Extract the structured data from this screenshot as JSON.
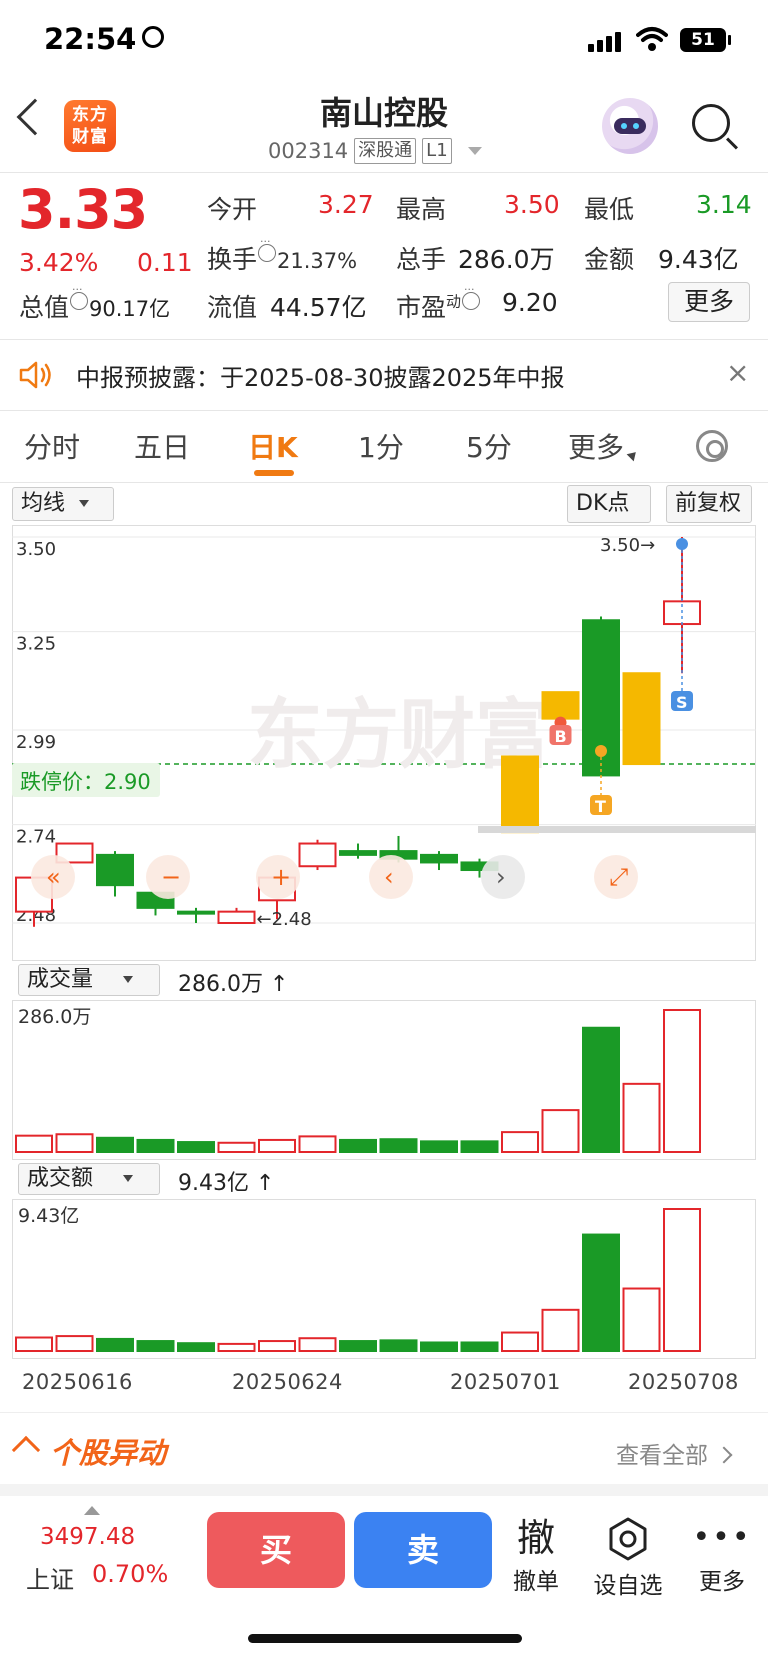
{
  "status_bar": {
    "time": "22:54",
    "battery": "51"
  },
  "header": {
    "logo_line1": "东方",
    "logo_line2": "财富",
    "stock_name": "南山控股",
    "stock_code": "002314",
    "connect_tag": "深股通",
    "level_tag": "L1"
  },
  "quote": {
    "price": "3.33",
    "change_pct": "3.42%",
    "change_amt": "0.11",
    "total_value_label": "总值",
    "total_value": "90.17亿",
    "rows": [
      [
        {
          "label": "今开",
          "value": "3.27",
          "color": "red"
        },
        {
          "label": "最高",
          "value": "3.50",
          "color": "red"
        },
        {
          "label": "最低",
          "value": "3.14",
          "color": "green"
        }
      ],
      [
        {
          "label": "换手",
          "value": "21.37%",
          "color": "dark"
        },
        {
          "label": "总手",
          "value": "286.0万",
          "color": "dark"
        },
        {
          "label": "金额",
          "value": "9.43亿",
          "color": "dark"
        }
      ],
      [
        {
          "label": "流值",
          "value": "44.57亿",
          "color": "dark"
        },
        {
          "label": "市盈",
          "value": "9.20",
          "color": "dark",
          "sup": "动"
        }
      ]
    ],
    "more_button": "更多"
  },
  "notice": {
    "text": "中报预披露：于2025-08-30披露2025年中报",
    "close": "×"
  },
  "tabs": [
    "分时",
    "五日",
    "日K",
    "1分",
    "5分",
    "更多"
  ],
  "active_tab": "日K",
  "colors": {
    "up": "#e3262b",
    "down": "#1a9a26",
    "accent": "#f07a12",
    "signal": "#f5b800",
    "limit_line": "#1a9a26"
  },
  "kline": {
    "indicator_selector": "均线",
    "dk_button": "DK点",
    "adjust_button": "前复权",
    "price_ticks": [
      "3.50",
      "3.25",
      "2.99",
      "2.74",
      "2.48"
    ],
    "limit_down_label": "跌停价：2.90",
    "max_marker": "3.50",
    "min_marker": "2.48",
    "signals": {
      "buy": "B",
      "sell": "S",
      "t": "T"
    }
  },
  "volume_panel": {
    "selector": "成交量",
    "value": "286.0万",
    "axis_max": "286.0万"
  },
  "amount_panel": {
    "selector": "成交额",
    "value": "9.43亿",
    "axis_max": "9.43亿"
  },
  "dates": [
    "20250616",
    "20250624",
    "20250701",
    "20250708"
  ],
  "chart_data": {
    "type": "candlestick",
    "ylim": [
      2.48,
      3.5
    ],
    "candles": [
      {
        "o": 2.51,
        "c": 2.6,
        "h": 2.6,
        "l": 2.47,
        "dir": "up"
      },
      {
        "o": 2.64,
        "c": 2.69,
        "h": 2.69,
        "l": 2.64,
        "dir": "up"
      },
      {
        "o": 2.66,
        "c": 2.58,
        "h": 2.67,
        "l": 2.55,
        "dir": "down"
      },
      {
        "o": 2.56,
        "c": 2.52,
        "h": 2.56,
        "l": 2.5,
        "dir": "down"
      },
      {
        "o": 2.51,
        "c": 2.51,
        "h": 2.52,
        "l": 2.48,
        "dir": "down"
      },
      {
        "o": 2.48,
        "c": 2.51,
        "h": 2.52,
        "l": 2.48,
        "dir": "up"
      },
      {
        "o": 2.54,
        "c": 2.6,
        "h": 2.6,
        "l": 2.49,
        "dir": "up"
      },
      {
        "o": 2.63,
        "c": 2.69,
        "h": 2.7,
        "l": 2.62,
        "dir": "up"
      },
      {
        "o": 2.67,
        "c": 2.66,
        "h": 2.69,
        "l": 2.65,
        "dir": "down"
      },
      {
        "o": 2.67,
        "c": 2.65,
        "h": 2.71,
        "l": 2.64,
        "dir": "down"
      },
      {
        "o": 2.66,
        "c": 2.64,
        "h": 2.67,
        "l": 2.62,
        "dir": "down"
      },
      {
        "o": 2.64,
        "c": 2.62,
        "h": 2.65,
        "l": 2.6,
        "dir": "down"
      },
      {
        "o": 2.72,
        "c": 2.92,
        "h": 2.92,
        "l": 2.72,
        "signal": true
      },
      {
        "o": 3.02,
        "c": 3.09,
        "h": 3.09,
        "l": 3.02,
        "signal": true
      },
      {
        "o": 3.28,
        "c": 2.87,
        "h": 3.29,
        "l": 2.87,
        "dir": "down"
      },
      {
        "o": 3.14,
        "c": 2.9,
        "h": 3.14,
        "l": 2.9,
        "signal": true
      },
      {
        "o": 3.27,
        "c": 3.33,
        "h": 3.5,
        "l": 3.14,
        "dir": "up"
      }
    ],
    "volume": [
      0.115,
      0.125,
      0.1,
      0.085,
      0.07,
      0.065,
      0.085,
      0.11,
      0.085,
      0.09,
      0.075,
      0.075,
      0.14,
      0.295,
      0.875,
      0.48,
      1.0
    ],
    "amount": [
      0.095,
      0.105,
      0.085,
      0.07,
      0.055,
      0.05,
      0.07,
      0.09,
      0.07,
      0.075,
      0.06,
      0.06,
      0.13,
      0.29,
      0.82,
      0.44,
      1.0
    ],
    "bar_dirs": [
      "up",
      "up",
      "down",
      "down",
      "down",
      "up",
      "up",
      "up",
      "down",
      "down",
      "down",
      "down",
      "up",
      "up",
      "down",
      "up",
      "up"
    ]
  },
  "section": {
    "title": "个股异动",
    "see_all": "查看全部"
  },
  "bottom_bar": {
    "index_value": "3497.48",
    "index_name": "上证",
    "index_change": "0.70%",
    "buy": "买",
    "sell": "卖",
    "cancel_icon": "撤",
    "cancel": "撤单",
    "watch": "设自选",
    "more": "更多"
  }
}
